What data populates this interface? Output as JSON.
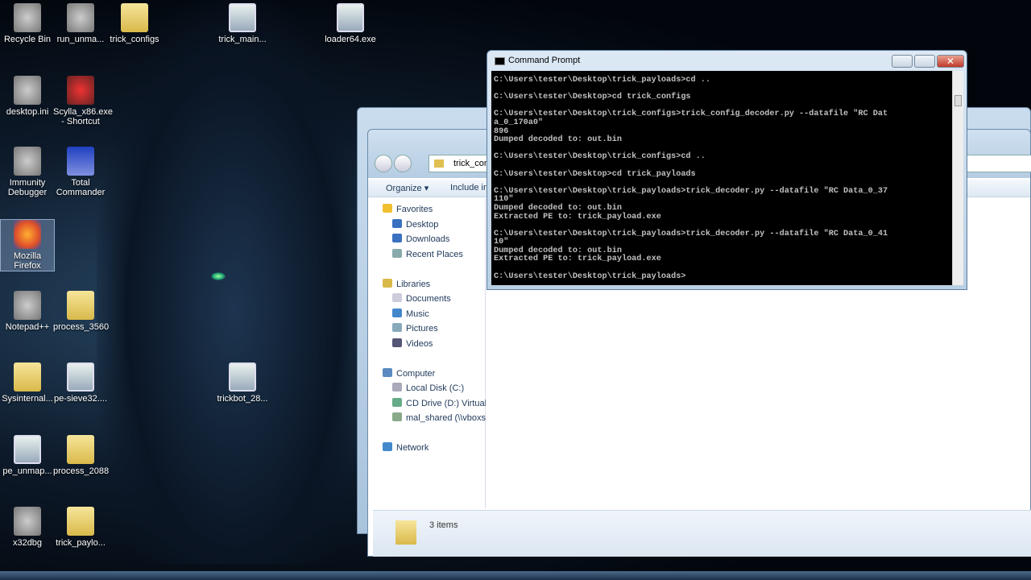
{
  "desktop_icons": [
    {
      "label": "Recycle Bin",
      "icon": "recycle-bin-icon"
    },
    {
      "label": "run_unma...",
      "icon": "gear-icon"
    },
    {
      "label": "trick_configs",
      "icon": "folder-icon"
    },
    {
      "label": "trick_main...",
      "icon": "exe-icon"
    },
    {
      "label": "loader64.exe",
      "icon": "exe-icon"
    },
    {
      "label": "desktop.ini",
      "icon": "gear-icon"
    },
    {
      "label": "Scylla_x86.exe - Shortcut",
      "icon": "scylla-icon"
    },
    {
      "label": "Immunity Debugger",
      "icon": "immunity-icon"
    },
    {
      "label": "Total Commander",
      "icon": "floppy-icon"
    },
    {
      "label": "Mozilla Firefox",
      "icon": "firefox-icon"
    },
    {
      "label": "Notepad++",
      "icon": "notepad-icon"
    },
    {
      "label": "process_3560",
      "icon": "folder-icon"
    },
    {
      "label": "Sysinternal...",
      "icon": "folder-icon"
    },
    {
      "label": "pe-sieve32....",
      "icon": "exe-icon"
    },
    {
      "label": "trickbot_28...",
      "icon": "exe-icon"
    },
    {
      "label": "pe_unmap...",
      "icon": "exe-icon"
    },
    {
      "label": "process_2088",
      "icon": "folder-icon"
    },
    {
      "label": "x32dbg",
      "icon": "bug-icon"
    },
    {
      "label": "trick_paylo...",
      "icon": "folder-icon"
    }
  ],
  "explorer": {
    "address": "trick_com",
    "toolbar": {
      "organize": "Organize",
      "include": "Include in"
    },
    "nav": [
      {
        "label": "Favorites",
        "color": "#f0c030"
      },
      {
        "label": "Desktop",
        "color": "#3a70c0"
      },
      {
        "label": "Downloads",
        "color": "#3a70c0"
      },
      {
        "label": "Recent Places",
        "color": "#8aa"
      },
      {
        "label": "",
        "color": ""
      },
      {
        "label": "Libraries",
        "color": "#d9b94a"
      },
      {
        "label": "Documents",
        "color": "#ccd"
      },
      {
        "label": "Music",
        "color": "#48c"
      },
      {
        "label": "Pictures",
        "color": "#8ab"
      },
      {
        "label": "Videos",
        "color": "#557"
      },
      {
        "label": "",
        "color": ""
      },
      {
        "label": "Computer",
        "color": "#5a8ac0"
      },
      {
        "label": "Local Disk (C:)",
        "color": "#aab"
      },
      {
        "label": "CD Drive (D:) Virtual",
        "color": "#6a8"
      },
      {
        "label": "mal_shared (\\\\vboxs",
        "color": "#8a8"
      },
      {
        "label": "",
        "color": ""
      },
      {
        "label": "Network",
        "color": "#48c"
      }
    ],
    "status": "3 items"
  },
  "cmd": {
    "title": "Command Prompt",
    "output": "C:\\Users\\tester\\Desktop\\trick_payloads>cd ..\n\nC:\\Users\\tester\\Desktop>cd trick_configs\n\nC:\\Users\\tester\\Desktop\\trick_configs>trick_config_decoder.py --datafile \"RC Dat\na_0_170a0\"\n896\nDumped decoded to: out.bin\n\nC:\\Users\\tester\\Desktop\\trick_configs>cd ..\n\nC:\\Users\\tester\\Desktop>cd trick_payloads\n\nC:\\Users\\tester\\Desktop\\trick_payloads>trick_decoder.py --datafile \"RC Data_0_37\n110\"\nDumped decoded to: out.bin\nExtracted PE to: trick_payload.exe\n\nC:\\Users\\tester\\Desktop\\trick_payloads>trick_decoder.py --datafile \"RC Data_0_41\n10\"\nDumped decoded to: out.bin\nExtracted PE to: trick_payload.exe\n\nC:\\Users\\tester\\Desktop\\trick_payloads>"
  }
}
